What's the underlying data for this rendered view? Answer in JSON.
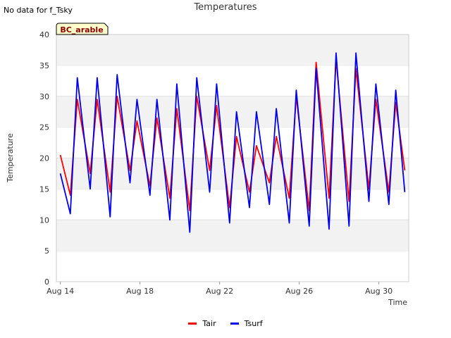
{
  "note": "No data for f_Tsky",
  "colors": {
    "Tair": "#ff0000",
    "Tsurf": "#0000ee",
    "band": "#f2f2f2",
    "badge_bg": "#ffffcc",
    "badge_text": "#8b0000"
  },
  "chart_data": {
    "type": "line",
    "title": "Temperatures",
    "xlabel": "Time",
    "ylabel": "Temperature",
    "badge": "BC_arable",
    "ylim": [
      0,
      40
    ],
    "yticks": [
      0,
      5,
      10,
      15,
      20,
      25,
      30,
      35,
      40
    ],
    "xlim": [
      13.8,
      31.5
    ],
    "xticks": [
      {
        "x": 14,
        "label": "Aug 14"
      },
      {
        "x": 18,
        "label": "Aug 18"
      },
      {
        "x": 22,
        "label": "Aug 22"
      },
      {
        "x": 26,
        "label": "Aug 26"
      },
      {
        "x": 30,
        "label": "Aug 30"
      }
    ],
    "grid": "horizontal alternating bands",
    "legend_position": "bottom-center",
    "series": [
      {
        "name": "Tair",
        "x": [
          14.0,
          14.5,
          14.85,
          15.5,
          15.85,
          16.5,
          16.85,
          17.5,
          17.85,
          18.5,
          18.85,
          19.5,
          19.85,
          20.5,
          20.85,
          21.5,
          21.85,
          22.5,
          22.85,
          23.5,
          23.85,
          24.5,
          24.85,
          25.5,
          25.85,
          26.5,
          26.85,
          27.5,
          27.85,
          28.5,
          28.85,
          29.5,
          29.85,
          30.5,
          30.85,
          31.3
        ],
        "y": [
          20.5,
          14,
          29.5,
          17.5,
          29.5,
          14.5,
          30,
          18,
          26,
          15.5,
          26.5,
          13.5,
          28,
          11.5,
          30,
          18,
          28.5,
          12,
          23.5,
          14.5,
          22,
          16,
          23.5,
          13.5,
          30,
          11.5,
          35.5,
          13.5,
          36,
          13,
          34.5,
          15,
          29.5,
          14.5,
          29,
          18
        ]
      },
      {
        "name": "Tsurf",
        "x": [
          14.0,
          14.5,
          14.85,
          15.5,
          15.85,
          16.5,
          16.85,
          17.5,
          17.85,
          18.5,
          18.85,
          19.5,
          19.85,
          20.5,
          20.85,
          21.5,
          21.85,
          22.5,
          22.85,
          23.5,
          23.85,
          24.5,
          24.85,
          25.5,
          25.85,
          26.5,
          26.85,
          27.5,
          27.85,
          28.5,
          28.85,
          29.5,
          29.85,
          30.5,
          30.85,
          31.3
        ],
        "y": [
          17.5,
          11,
          33,
          15,
          33,
          10.5,
          33.5,
          16,
          29.5,
          14,
          29.5,
          10,
          32,
          8,
          33,
          14.5,
          32,
          9.5,
          27.5,
          12,
          27.5,
          12.5,
          28,
          9.5,
          31,
          9,
          34.5,
          8.5,
          37,
          9,
          37,
          13,
          32,
          12.5,
          31,
          14.5
        ]
      }
    ]
  }
}
